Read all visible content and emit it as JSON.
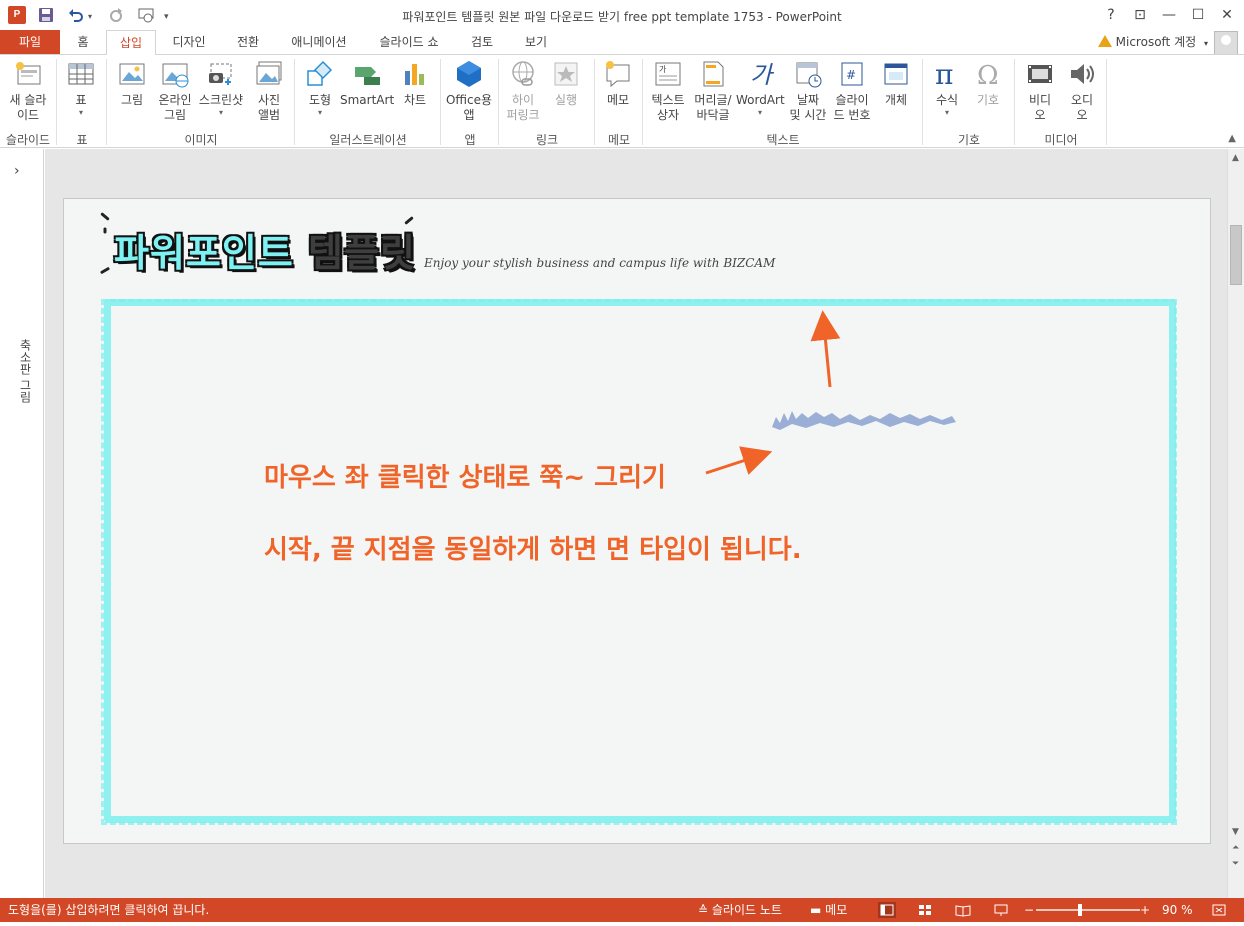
{
  "window": {
    "title": "파워포인트 템플릿 원본 파일 다운로드 받기 free ppt template 1753 - PowerPoint",
    "app_badge": "P",
    "help": "?",
    "ribbon_display": "⊡",
    "minimize": "—",
    "maximize": "☐",
    "close": "✕"
  },
  "tabs": {
    "file": "파일",
    "home": "홈",
    "insert": "삽입",
    "design": "디자인",
    "transitions": "전환",
    "animations": "애니메이션",
    "slideshow": "슬라이드 쇼",
    "review": "검토",
    "view": "보기"
  },
  "account": {
    "label": "Microsoft 계정",
    "caret": "▾"
  },
  "ribbon": {
    "new_slide": [
      "새 슬라",
      "이드"
    ],
    "table": "표",
    "picture": "그림",
    "online_picture": [
      "온라인",
      "그림"
    ],
    "screenshot": "스크린샷",
    "photo_album": [
      "사진",
      "앨범"
    ],
    "shapes": "도형",
    "smartart": "SmartArt",
    "chart": "차트",
    "office_apps": [
      "Office용",
      "앱"
    ],
    "hyperlink": [
      "하이",
      "퍼링크"
    ],
    "action": "실행",
    "comment": "메모",
    "textbox": [
      "텍스트",
      "상자"
    ],
    "header_footer": [
      "머리글/",
      "바닥글"
    ],
    "wordart": "WordArt",
    "date_time": [
      "날짜",
      "및 시간"
    ],
    "slide_number": [
      "슬라이",
      "드 번호"
    ],
    "object": "개체",
    "equation": "수식",
    "symbol": "기호",
    "video": [
      "비디",
      "오"
    ],
    "audio": [
      "오디",
      "오"
    ],
    "groups": {
      "slides": "슬라이드",
      "tables": "표",
      "images": "이미지",
      "illustrations": "일러스트레이션",
      "apps": "앱",
      "links": "링크",
      "comments": "메모",
      "text": "텍스트",
      "symbols": "기호",
      "media": "미디어"
    }
  },
  "thumb_pane": {
    "expand": "›",
    "label": "축소판 그림"
  },
  "slide": {
    "title_part1": "파워포인트",
    "title_part2": "템플릿",
    "subtitle": "Enjoy your stylish business and campus life with BIZCAM",
    "line1": "마우스 좌 클릭한 상태로 쭉~ 그리기",
    "line2": "시작, 끝 지점을 동일하게 하면 면 타입이 됩니다.",
    "frame_color": "#8ff0f0",
    "text_color": "#f0642a",
    "arrow_color": "#f0642a",
    "scribble_color": "#9aaed6"
  },
  "status": {
    "message": "도형을(를) 삽입하려면 클릭하여 끕니다.",
    "notes": "슬라이드 노트",
    "comments": "메모",
    "zoom": "90 %",
    "zoom_minus": "−",
    "zoom_plus": "+",
    "bar_color": "#d24726"
  }
}
